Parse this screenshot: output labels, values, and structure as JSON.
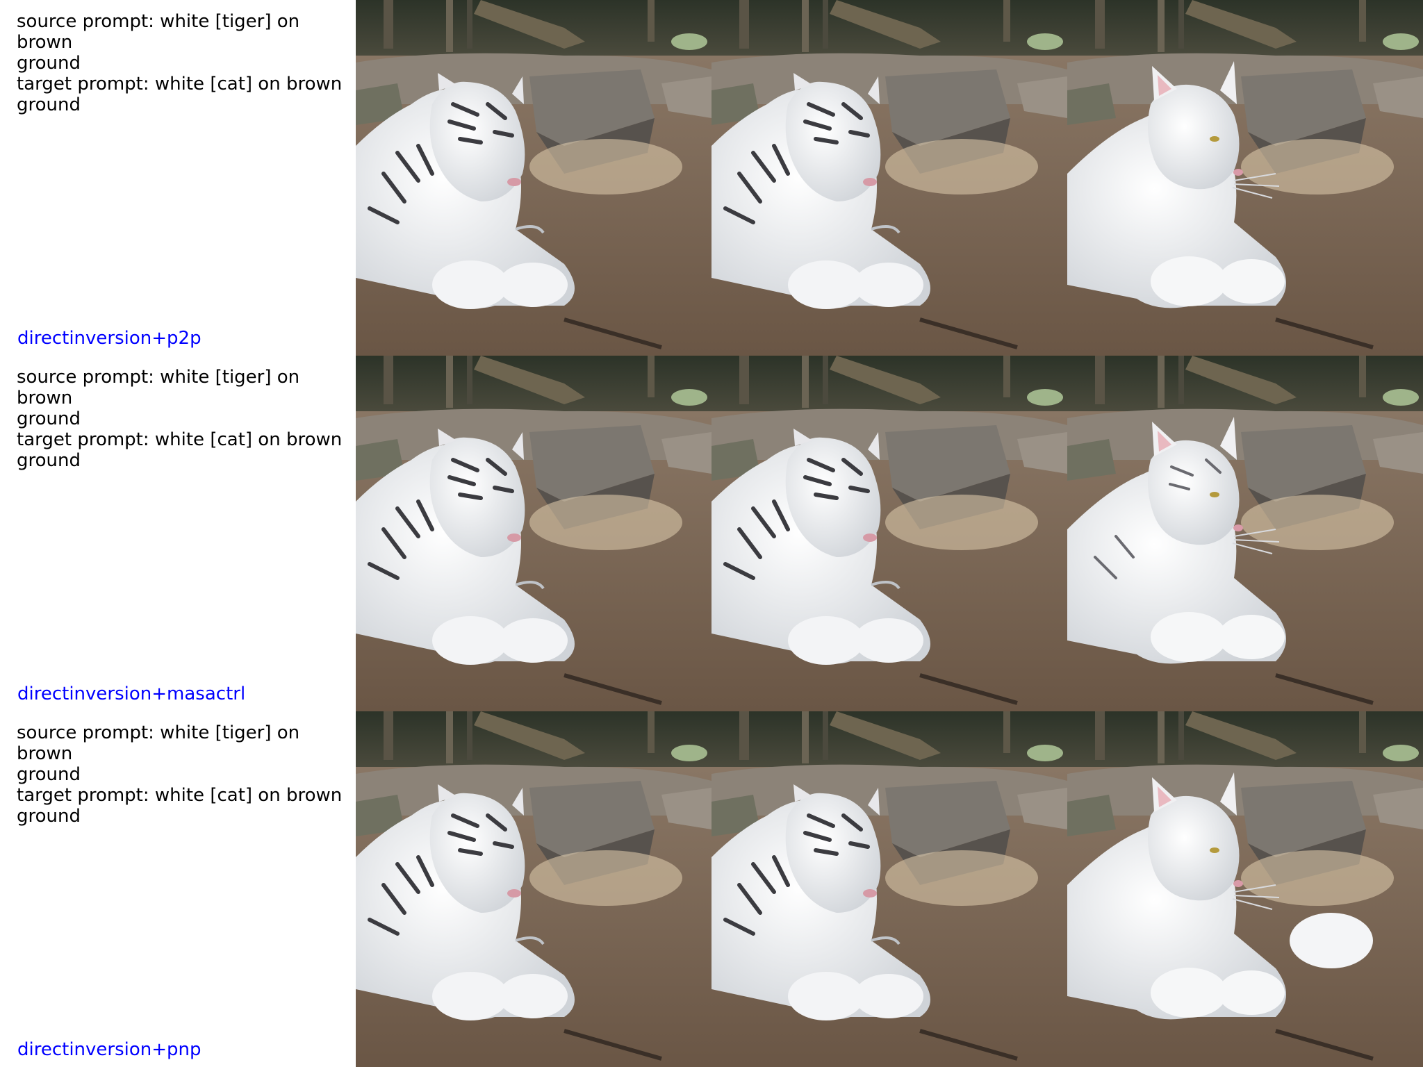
{
  "rows": [
    {
      "source_prompt": "source prompt: white [tiger] on brown\nground",
      "target_prompt": "target prompt: white [cat] on brown\nground",
      "method": "directinversion+p2p",
      "images": [
        "white-tiger-source",
        "white-tiger-reconstruction",
        "white-cat-edited"
      ]
    },
    {
      "source_prompt": "source prompt: white [tiger] on brown\nground",
      "target_prompt": "target prompt: white [cat] on brown\nground",
      "method": "directinversion+masactrl",
      "images": [
        "white-tiger-source",
        "white-tiger-reconstruction",
        "striped-white-cat-edited"
      ]
    },
    {
      "source_prompt": "source prompt: white [tiger] on brown\nground",
      "target_prompt": "target prompt: white [cat] on brown\nground",
      "method": "directinversion+pnp",
      "images": [
        "white-tiger-source",
        "white-tiger-reconstruction",
        "fluffy-white-cat-edited"
      ]
    }
  ],
  "colors": {
    "method_label": "#0000ff",
    "prompt_text": "#000000",
    "ground": "#7a6757",
    "rock": "#8a8178",
    "fur": "#eef0f2",
    "stripes": "#3b3b40"
  }
}
